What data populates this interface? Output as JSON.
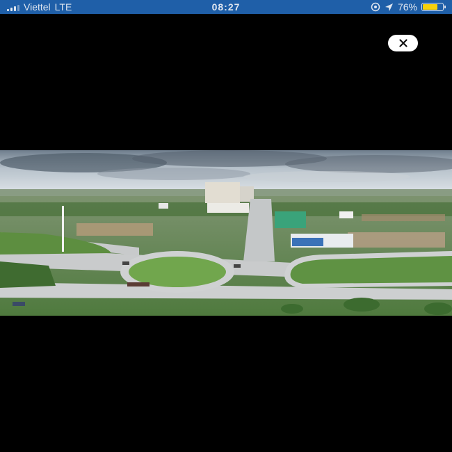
{
  "status_bar": {
    "carrier": "Viettel",
    "network": "LTE",
    "time": "08:27",
    "battery_percent": "76%",
    "battery_level": 0.76,
    "background_color": "#1f5fa8",
    "battery_color": "#f6d10b"
  },
  "viewer": {
    "background_color": "#000000",
    "close_icon": "close-icon"
  }
}
